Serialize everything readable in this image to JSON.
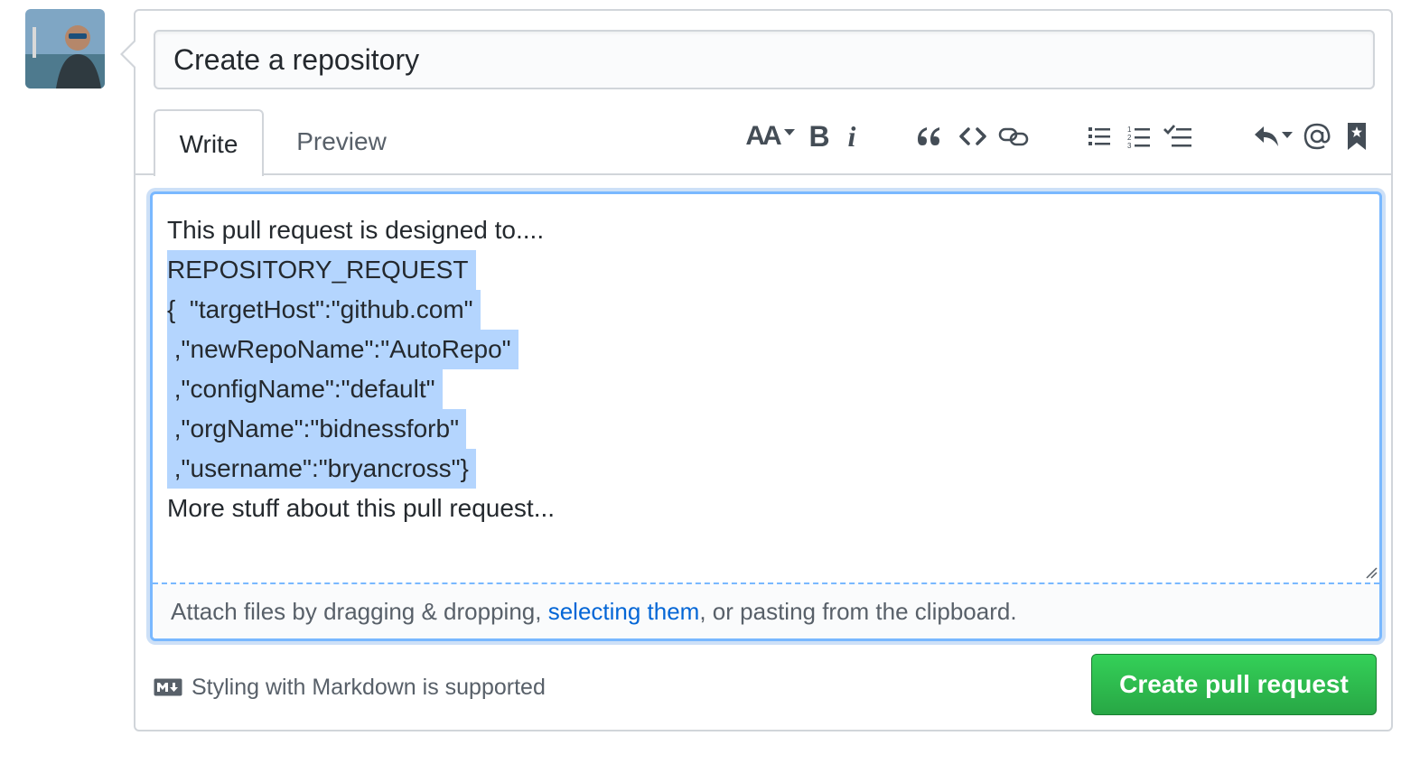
{
  "title_input": {
    "value": "Create a repository"
  },
  "tabs": [
    {
      "label": "Write",
      "active": true
    },
    {
      "label": "Preview",
      "active": false
    }
  ],
  "toolbar": {
    "heading_label": "AA",
    "bold_label": "B",
    "italic_label": "i",
    "icons": [
      "header-icon",
      "bold-icon",
      "italic-icon",
      "quote-icon",
      "code-icon",
      "link-icon",
      "bullet-list-icon",
      "numbered-list-icon",
      "task-list-icon",
      "reply-icon",
      "mention-icon",
      "bookmark-icon"
    ]
  },
  "editor": {
    "lines": [
      "This pull request is designed to....",
      "REPOSITORY_REQUEST",
      "{  \"targetHost\":\"github.com\"",
      " ,\"newRepoName\":\"AutoRepo\"",
      " ,\"configName\":\"default\"",
      " ,\"orgName\":\"bidnessforb\"",
      " ,\"username\":\"bryancross\"}",
      "More stuff about this pull request..."
    ],
    "selected_line_indexes": [
      1,
      2,
      3,
      4,
      5,
      6
    ]
  },
  "dropzone": {
    "before": "Attach files by dragging & dropping, ",
    "link": "selecting them",
    "after": ", or pasting from the clipboard."
  },
  "markdown_hint": "Styling with Markdown is supported",
  "submit_button": "Create pull request",
  "colors": {
    "accent": "#0366d6",
    "focus_border": "#79b8ff",
    "selection": "#b4d5fe",
    "submit_green": "#28a745"
  }
}
